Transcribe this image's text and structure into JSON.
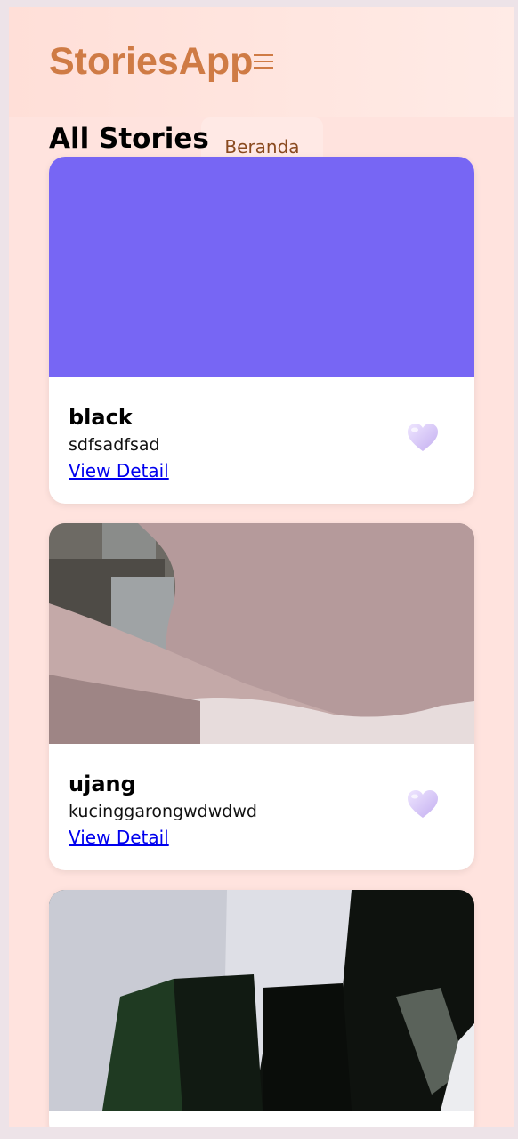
{
  "header": {
    "app_title": "StoriesApp"
  },
  "nav": {
    "home_label": "Beranda"
  },
  "main": {
    "section_title": "All Stories",
    "stories": [
      {
        "name": "black",
        "description": "sdfsadfsad",
        "link_label": "View Detail"
      },
      {
        "name": "ujang",
        "description": "kucinggarongwdwdwd",
        "link_label": "View Detail"
      },
      {
        "name": "",
        "description": "",
        "link_label": ""
      }
    ]
  },
  "icons": {
    "menu": "hamburger-menu-icon",
    "like": "heart-icon"
  },
  "colors": {
    "brand": "#cf7b45",
    "page_background": "#ffe3de",
    "link": "#0000ee",
    "story_1_image": "#7766f4",
    "heart": "#d9c8f5"
  }
}
